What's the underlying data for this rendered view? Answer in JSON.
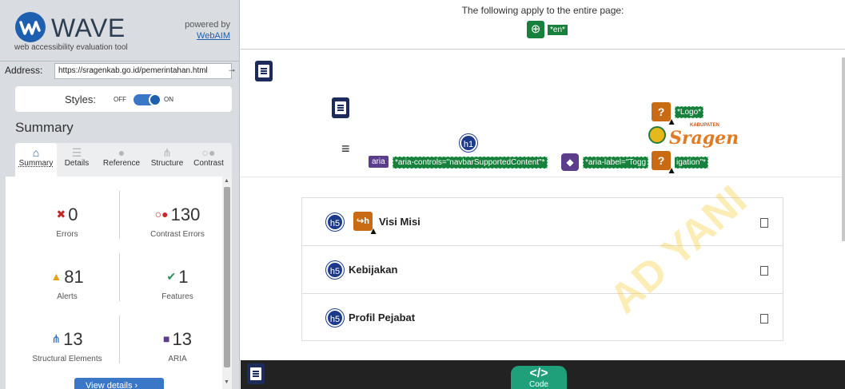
{
  "wave": {
    "title": "WAVE",
    "tagline": "web accessibility evaluation tool",
    "powered_by": "powered by",
    "webaim": "WebAIM"
  },
  "address": {
    "label": "Address:",
    "value": "https://sragenkab.go.id/pemerintahan.html",
    "go": "→"
  },
  "styles": {
    "label": "Styles:",
    "off": "OFF",
    "on": "ON"
  },
  "summary_heading": "Summary",
  "tabs": [
    {
      "label": "Summary",
      "icon": "home-icon",
      "glyph": "⌂"
    },
    {
      "label": "Details",
      "icon": "list-icon",
      "glyph": "☰"
    },
    {
      "label": "Reference",
      "icon": "info-icon",
      "glyph": "●"
    },
    {
      "label": "Structure",
      "icon": "structure-icon",
      "glyph": "⋔"
    },
    {
      "label": "Contrast",
      "icon": "contrast-icon",
      "glyph": "○●"
    }
  ],
  "stats": {
    "errors": {
      "num": "0",
      "label": "Errors",
      "icon": "error-icon",
      "glyph": "✖",
      "color": "#c62828"
    },
    "contrast": {
      "num": "130",
      "label": "Contrast Errors",
      "icon": "contrast-error-icon",
      "glyph": "○●",
      "color": "#c62828"
    },
    "alerts": {
      "num": "81",
      "label": "Alerts",
      "icon": "alert-icon",
      "glyph": "▲",
      "color": "#e6a118"
    },
    "features": {
      "num": "1",
      "label": "Features",
      "icon": "feature-icon",
      "glyph": "✔",
      "color": "#2e8b57"
    },
    "structural": {
      "num": "13",
      "label": "Structural Elements",
      "icon": "structure-icon",
      "glyph": "⋔",
      "color": "#1f5fb0"
    },
    "aria": {
      "num": "13",
      "label": "ARIA",
      "icon": "aria-icon",
      "glyph": "■",
      "color": "#5b3d8c"
    }
  },
  "view_details": "View details ›",
  "page": {
    "entire_text": "The following apply to the entire page:",
    "lang_label": "*en*",
    "h1": "h1",
    "aria": "aria",
    "aria_controls": "*aria-controls=\"navbarSupportedContent\"*",
    "aria_label": "*aria-label=\"Togg",
    "aria_label_tail": "igation\"*",
    "logo_label": "*Logo*",
    "logo_kab": "KABUPATEN",
    "logo_name": "Sragen",
    "h5": "h5",
    "items": [
      {
        "title": "Visi Misi"
      },
      {
        "title": "Kebijakan"
      },
      {
        "title": "Profil Pejabat"
      }
    ],
    "code_symbol": "</>",
    "code_label": "Code",
    "watermark": "AD YANI"
  }
}
